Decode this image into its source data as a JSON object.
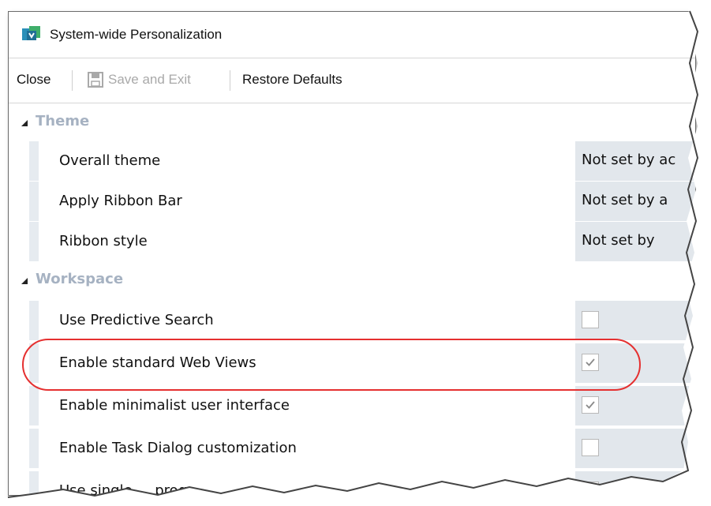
{
  "window": {
    "title": "System-wide Personalization",
    "icon": "app-icon"
  },
  "toolbar": {
    "close_label": "Close",
    "save_exit_label": "Save and Exit",
    "restore_defaults_label": "Restore Defaults"
  },
  "sections": [
    {
      "label": "Theme",
      "rows": [
        {
          "label": "Overall theme",
          "value": "Not set by ac"
        },
        {
          "label": "Apply Ribbon Bar",
          "value": "Not set by a"
        },
        {
          "label": "Ribbon style",
          "value": "Not set by"
        }
      ]
    },
    {
      "label": "Workspace",
      "rows": [
        {
          "label": "Use Predictive Search",
          "checked": false
        },
        {
          "label": "Enable standard Web Views",
          "checked": true,
          "highlighted": true
        },
        {
          "label": "Enable minimalist user interface",
          "checked": true
        },
        {
          "label": "Enable Task Dialog customization",
          "checked": false
        },
        {
          "label": "Use single ... prog",
          "checked": false
        }
      ]
    }
  ],
  "colors": {
    "section_label": "#a6b2c2",
    "value_cell_bg": "#e2e7ec",
    "highlight_ring": "#e53030",
    "disabled_text": "#a9a9a9"
  }
}
